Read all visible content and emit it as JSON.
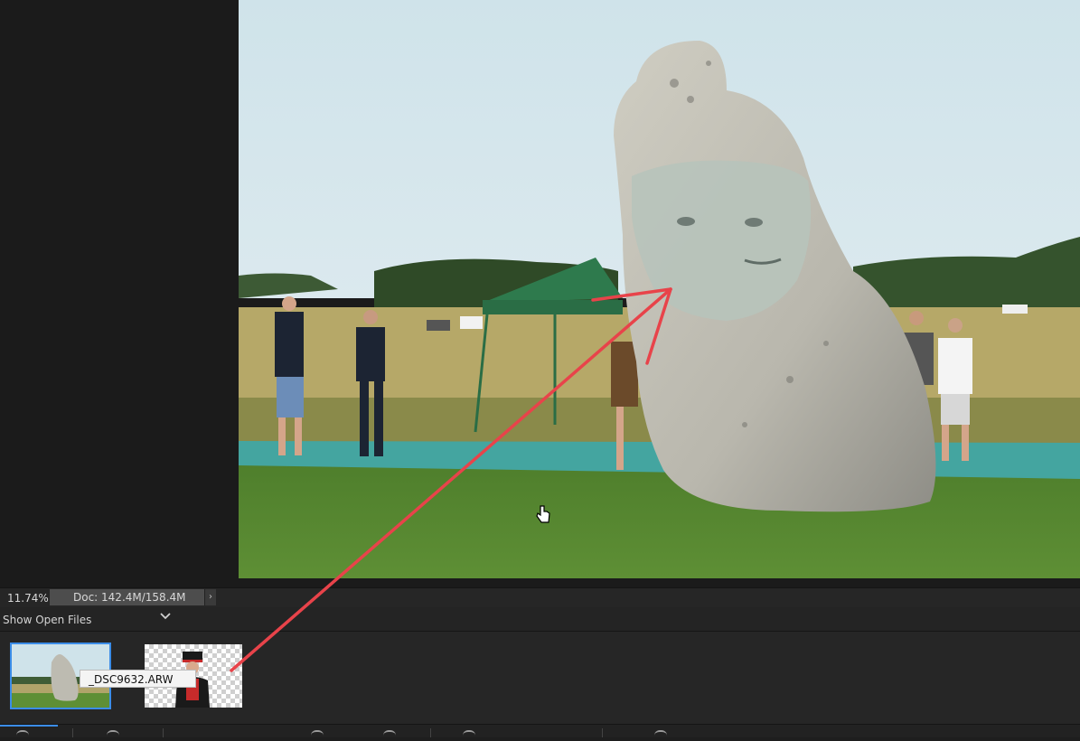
{
  "status": {
    "zoom": "11.74%",
    "doc_info": "Doc: 142.4M/158.4M",
    "arrow_glyph": "›"
  },
  "files_panel": {
    "label": "Show Open Files",
    "files": [
      {
        "name": "_DSC9632.ARW",
        "selected": true
      },
      {
        "name": "",
        "selected": false
      }
    ],
    "tooltip": "_DSC9632.ARW"
  },
  "colors": {
    "accent": "#3b8de8",
    "annotation_arrow": "#e8434a"
  },
  "icons": [
    "chevron-down-icon",
    "hand-cursor-icon"
  ]
}
